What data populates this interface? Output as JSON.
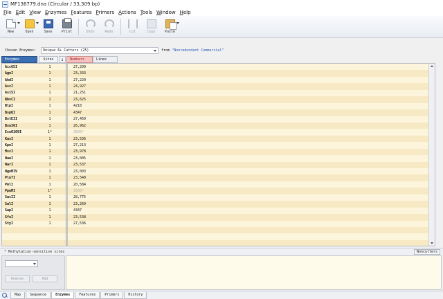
{
  "window": {
    "title": "MF136779.dna  (Circular / 33,309 bp)"
  },
  "menu": [
    "File",
    "Edit",
    "View",
    "Enzymes",
    "Features",
    "Primers",
    "Actions",
    "Tools",
    "Window",
    "Help"
  ],
  "toolbar": {
    "new": "New",
    "open": "Open",
    "save": "Save",
    "print": "Print",
    "undo": "Undo",
    "redo": "Redo",
    "cut": "Cut",
    "copy": "Copy",
    "paste": "Paste"
  },
  "filter": {
    "label": "Chosen Enzymes:",
    "selected": "Unique 6+ Cutters  (25)",
    "from_label": "from",
    "source": "\"Nonredundant Commercial\""
  },
  "columns": {
    "enzymes": "Enzymes",
    "sites": "Sites",
    "sort_glyph": "↓",
    "numbers": "Numbers",
    "lines": "Lines"
  },
  "enzymes": [
    {
      "name": "Acc65I",
      "sites": "1",
      "position": "27,209"
    },
    {
      "name": "AgeI",
      "sites": "1",
      "position": "23,333"
    },
    {
      "name": "AhdI",
      "sites": "1",
      "position": "27,220"
    },
    {
      "name": "AscI",
      "sites": "1",
      "position": "24,927"
    },
    {
      "name": "AsiSI",
      "sites": "1",
      "position": "21,251"
    },
    {
      "name": "BbvCI",
      "sites": "1",
      "position": "23,625"
    },
    {
      "name": "BlpI",
      "sites": "1",
      "position": "4218"
    },
    {
      "name": "BspQI",
      "sites": "1",
      "position": "4347"
    },
    {
      "name": "BstEII",
      "sites": "1",
      "position": "27,450"
    },
    {
      "name": "Bsu36I",
      "sites": "1",
      "position": "26,962"
    },
    {
      "name": "EcoO109I",
      "sites": "1*",
      "position": "3505*",
      "faded": true
    },
    {
      "name": "KasI",
      "sites": "1",
      "position": "23,536"
    },
    {
      "name": "KpnI",
      "sites": "1",
      "position": "27,213"
    },
    {
      "name": "MscI",
      "sites": "1",
      "position": "23,978"
    },
    {
      "name": "NaeI",
      "sites": "1",
      "position": "23,005"
    },
    {
      "name": "NarI",
      "sites": "1",
      "position": "23,537"
    },
    {
      "name": "NgoMIV",
      "sites": "1",
      "position": "23,003"
    },
    {
      "name": "PluTI",
      "sites": "1",
      "position": "23,540"
    },
    {
      "name": "PmlI",
      "sites": "1",
      "position": "20,584"
    },
    {
      "name": "PpuMI",
      "sites": "1*",
      "position": "3505*",
      "faded": true
    },
    {
      "name": "SacII",
      "sites": "1",
      "position": "28,775"
    },
    {
      "name": "SalI",
      "sites": "1",
      "position": "23,269"
    },
    {
      "name": "SapI",
      "sites": "1",
      "position": "4347"
    },
    {
      "name": "SfoI",
      "sites": "1",
      "position": "23,538"
    },
    {
      "name": "StyI",
      "sites": "1",
      "position": "27,536"
    }
  ],
  "status": {
    "note": "* Methylation-sensitive sites",
    "noncutters": "Noncutters"
  },
  "bottom_left": {
    "remove": "Remove",
    "add": "Add"
  },
  "tabs": [
    "Map",
    "Sequence",
    "Enzymes",
    "Features",
    "Primers",
    "History"
  ],
  "active_tab": "Enzymes"
}
